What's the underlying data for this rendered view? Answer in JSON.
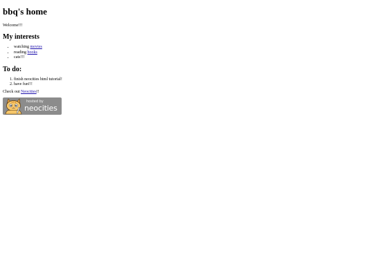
{
  "page": {
    "title": "bbq's home",
    "welcome": "Welcome!!!"
  },
  "interests": {
    "heading": "My interests",
    "items": [
      {
        "prefix": "watching ",
        "link": "movies"
      },
      {
        "prefix": "reading ",
        "link": "books"
      },
      {
        "text": "cats!!!"
      }
    ]
  },
  "todo": {
    "heading": "To do:",
    "items": [
      "finish neocities html tutorial!",
      "have fun!!!"
    ]
  },
  "footer": {
    "prefix": "Check out ",
    "link": "Neocities",
    "suffix": "!!"
  },
  "badge": {
    "hosted_by": "hosted by",
    "name": "neocities",
    "icon": "neocities-cat-icon",
    "bg_color": "#8c8c8c",
    "cat_color": "#f2a541"
  },
  "colors": {
    "link": "#1a0dab",
    "text": "#000000",
    "background": "#ffffff"
  }
}
